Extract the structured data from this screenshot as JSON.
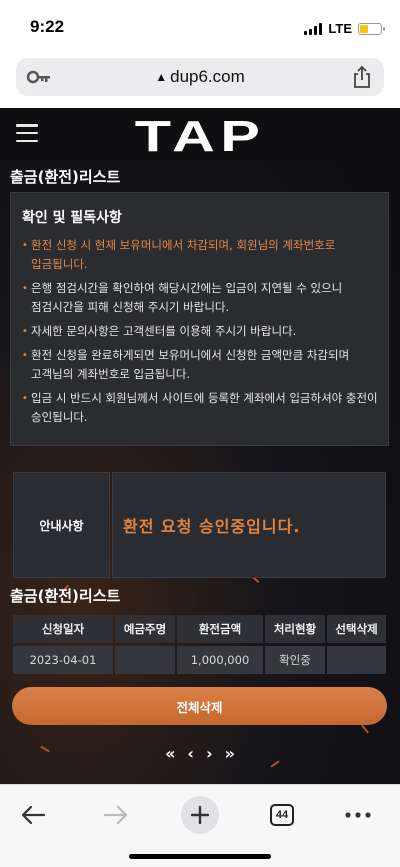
{
  "status": {
    "time": "9:22",
    "network": "LTE"
  },
  "browser": {
    "url": "dup6.com"
  },
  "site": {
    "logo": "TAP"
  },
  "withdraw_section_title": "출금(환전)리스트",
  "notice": {
    "title": "확인 및 필독사항",
    "items": [
      "환전 신청 시 현재 보유머니에서 차감되며, 회원님의 계좌번호로 입금됩니다.",
      "은행 점검시간을 확인하여 해당시간에는 입금이 지연될 수 있으니 점검시간을 피해 신청해 주시기 바랍니다.",
      "자세한 문의사항은 고객센터를 이용해 주시기 바랍니다.",
      "환전 신청을 완료하게되면 보유머니에서 신청한 금액만큼 차감되며 고객님의 계좌번호로 입금됩니다.",
      "입금 시 반드시 회원님께서 사이트에 등록한 계좌에서 입금하셔야 충전이 승인됩니다."
    ]
  },
  "guide": {
    "label": "안내사항",
    "message": "환전 요청 승인중입니다."
  },
  "list_title": "출금(환전)리스트",
  "table": {
    "headers": [
      "신청일자",
      "예금주명",
      "환전금액",
      "처리현황",
      "선택삭제"
    ],
    "rows": [
      [
        "2023-04-01",
        "",
        "1,000,000",
        "확인중",
        ""
      ]
    ]
  },
  "delete_all_label": "전체삭제",
  "pagination": {
    "first": "«",
    "prev": "‹",
    "next": "›",
    "last": "»"
  },
  "toolbar": {
    "tab_count": "44"
  },
  "colors": {
    "accent": "#d9804a",
    "highlight_text": "#e58a4a",
    "background": "#15151a"
  },
  "icons": [
    "key-icon",
    "lock-icon",
    "share-icon",
    "hamburger-icon",
    "back-icon",
    "forward-icon",
    "plus-icon",
    "tabs-icon",
    "more-icon"
  ]
}
